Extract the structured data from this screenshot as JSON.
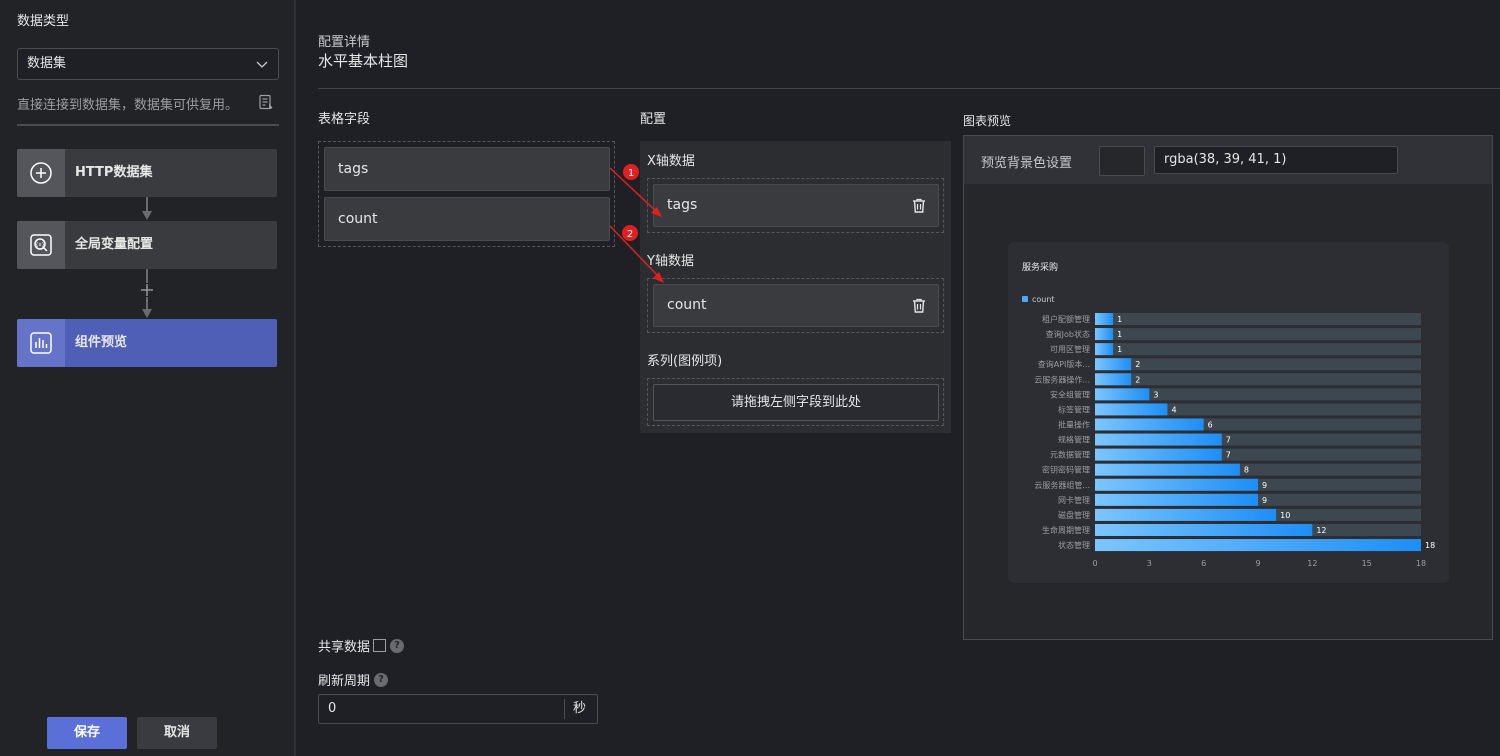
{
  "sidebar": {
    "title": "数据类型",
    "select_value": "数据集",
    "description": "直接连接到数据集，数据集可供复用。",
    "steps": [
      {
        "label": "HTTP数据集",
        "icon": "plus-circle-icon"
      },
      {
        "label": "全局变量配置",
        "icon": "variable-search-icon"
      },
      {
        "label": "组件预览",
        "icon": "chart-preview-icon"
      }
    ],
    "save_label": "保存",
    "cancel_label": "取消"
  },
  "header": {
    "subtitle": "配置详情",
    "title": "水平基本柱图"
  },
  "fields": {
    "label": "表格字段",
    "items": [
      "tags",
      "count"
    ]
  },
  "config": {
    "label": "配置",
    "x_label": "X轴数据",
    "x_value": "tags",
    "y_label": "Y轴数据",
    "y_value": "count",
    "series_label": "系列(图例项)",
    "series_placeholder": "请拖拽左侧字段到此处",
    "markers": [
      "1",
      "2"
    ]
  },
  "preview": {
    "label": "图表预览",
    "bg_label": "预览背景色设置",
    "bg_value": "rgba(38, 39, 41, 1)"
  },
  "options": {
    "share_label": "共享数据",
    "refresh_label": "刷新周期",
    "refresh_value": "0",
    "refresh_unit": "秒",
    "help_glyph": "?"
  },
  "colors": {
    "accent": "#5b6fd9",
    "bar_start": "#7cc6ff",
    "bar_end": "#1e8ef5",
    "track": "#3c474f",
    "arrow": "#e02020"
  },
  "chart_data": {
    "type": "bar",
    "orientation": "horizontal",
    "title": "服务采购",
    "legend": [
      "count"
    ],
    "categories": [
      "租户配额管理",
      "查询Job状态",
      "可用区管理",
      "查询API版本...",
      "云服务器操作...",
      "安全组管理",
      "标签管理",
      "批量操作",
      "规格管理",
      "元数据管理",
      "密钥密码管理",
      "云服务器组管...",
      "网卡管理",
      "磁盘管理",
      "生命周期管理",
      "状态管理"
    ],
    "values": [
      1,
      1,
      1,
      2,
      2,
      3,
      4,
      6,
      7,
      7,
      8,
      9,
      9,
      10,
      12,
      18
    ],
    "x_ticks": [
      0,
      3,
      6,
      9,
      12,
      15,
      18
    ],
    "xlim": [
      0,
      18
    ],
    "grid": false,
    "legend_position": "top-left"
  }
}
